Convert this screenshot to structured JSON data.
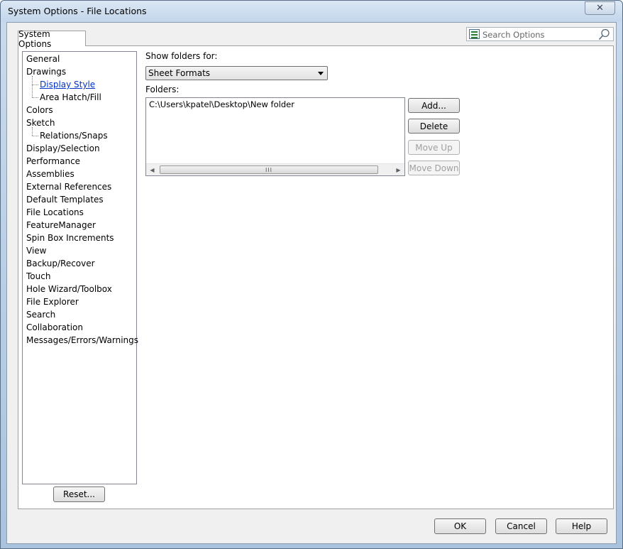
{
  "window": {
    "title": "System Options - File Locations",
    "close_glyph": "✕"
  },
  "tab": {
    "label": "System Options"
  },
  "search": {
    "placeholder": "Search Options"
  },
  "tree": {
    "items": [
      {
        "label": "General",
        "level": 0
      },
      {
        "label": "Drawings",
        "level": 0
      },
      {
        "label": "Display Style",
        "level": 1,
        "selected": true
      },
      {
        "label": "Area Hatch/Fill",
        "level": 1
      },
      {
        "label": "Colors",
        "level": 0
      },
      {
        "label": "Sketch",
        "level": 0
      },
      {
        "label": "Relations/Snaps",
        "level": 1
      },
      {
        "label": "Display/Selection",
        "level": 0
      },
      {
        "label": "Performance",
        "level": 0
      },
      {
        "label": "Assemblies",
        "level": 0
      },
      {
        "label": "External References",
        "level": 0
      },
      {
        "label": "Default Templates",
        "level": 0
      },
      {
        "label": "File Locations",
        "level": 0
      },
      {
        "label": "FeatureManager",
        "level": 0
      },
      {
        "label": "Spin Box Increments",
        "level": 0
      },
      {
        "label": "View",
        "level": 0
      },
      {
        "label": "Backup/Recover",
        "level": 0
      },
      {
        "label": "Touch",
        "level": 0
      },
      {
        "label": "Hole Wizard/Toolbox",
        "level": 0
      },
      {
        "label": "File Explorer",
        "level": 0
      },
      {
        "label": "Search",
        "level": 0
      },
      {
        "label": "Collaboration",
        "level": 0
      },
      {
        "label": "Messages/Errors/Warnings",
        "level": 0
      }
    ]
  },
  "reset_label": "Reset...",
  "show_folders": {
    "label": "Show folders for:",
    "value": "Sheet Formats"
  },
  "folders": {
    "label": "Folders:",
    "rows": [
      "C:\\Users\\kpatel\\Desktop\\New folder"
    ],
    "scroll_left": "◀",
    "scroll_right": "▶",
    "thumb_grip": "III"
  },
  "folder_buttons": {
    "add": "Add...",
    "delete": "Delete",
    "move_up": "Move Up",
    "move_down": "Move Down"
  },
  "dialog_buttons": {
    "ok": "OK",
    "cancel": "Cancel",
    "help": "Help"
  }
}
